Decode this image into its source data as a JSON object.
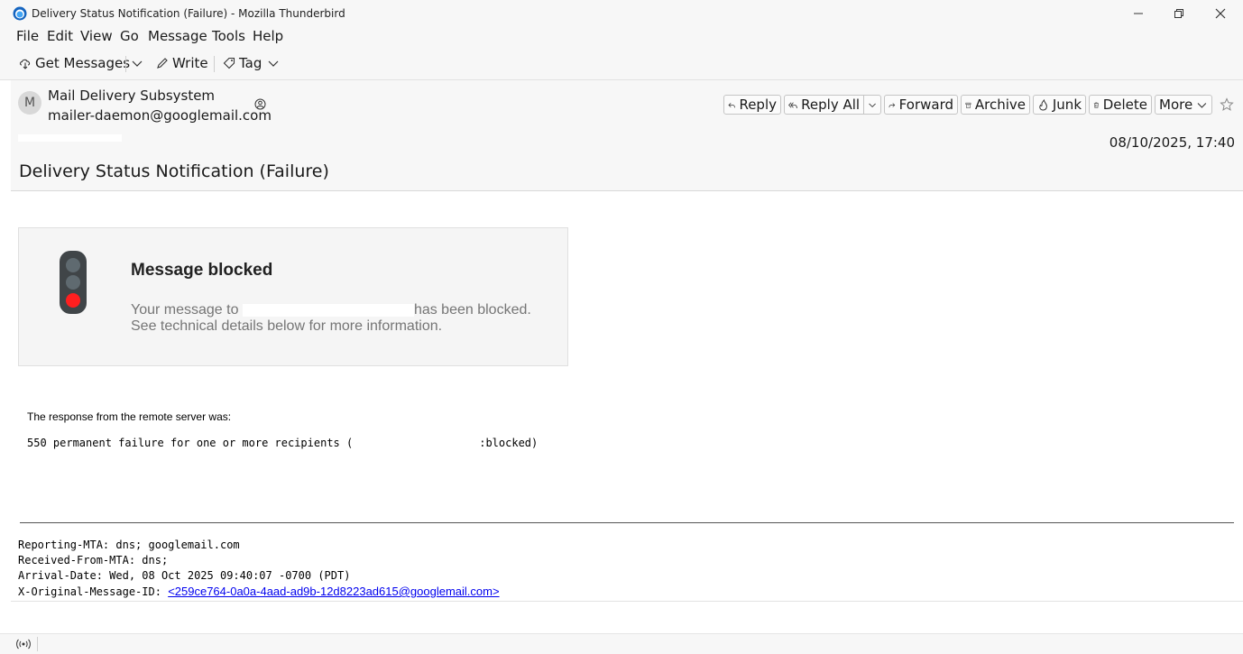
{
  "window": {
    "title": "Delivery Status Notification (Failure) - Mozilla Thunderbird"
  },
  "menu": [
    {
      "label": "File"
    },
    {
      "label": "Edit"
    },
    {
      "label": "View"
    },
    {
      "label": "Go"
    },
    {
      "label": "Message"
    },
    {
      "label": "Tools"
    },
    {
      "label": "Help"
    }
  ],
  "toolbar": {
    "get_messages": "Get Messages",
    "write": "Write",
    "tag": "Tag"
  },
  "message": {
    "avatar_initial": "M",
    "sender_name": "Mail Delivery Subsystem",
    "sender_email": "mailer-daemon@googlemail.com",
    "date": "08/10/2025, 17:40",
    "subject": "Delivery Status Notification (Failure)"
  },
  "actions": {
    "reply": "Reply",
    "reply_all": "Reply All",
    "forward": "Forward",
    "archive": "Archive",
    "junk": "Junk",
    "delete": "Delete",
    "more": "More"
  },
  "body": {
    "card_title": "Message blocked",
    "card_line1_prefix": "Your message to",
    "card_line1_suffix": "has been blocked.",
    "card_line2": "See technical details below for more information.",
    "response_label": "The response from the remote server was:",
    "response_prefix": "550 permanent failure for one or more recipients (",
    "response_suffix": ":blocked)",
    "reporting_mta": "Reporting-MTA: dns; googlemail.com",
    "received_from_mta": "Received-From-MTA: dns;",
    "arrival_date": "Arrival-Date: Wed, 08 Oct 2025 09:40:07 -0700 (PDT)",
    "original_message_id_label": "X-Original-Message-ID:",
    "original_message_id": "<259ce764-0a0a-4aad-ad9b-12d8223ad615@googlemail.com>"
  },
  "colors": {
    "traffic_light_body": "#404548",
    "traffic_light_off": "#5f6a70",
    "traffic_light_red": "#ff1f1f",
    "link": "#0000ee"
  }
}
